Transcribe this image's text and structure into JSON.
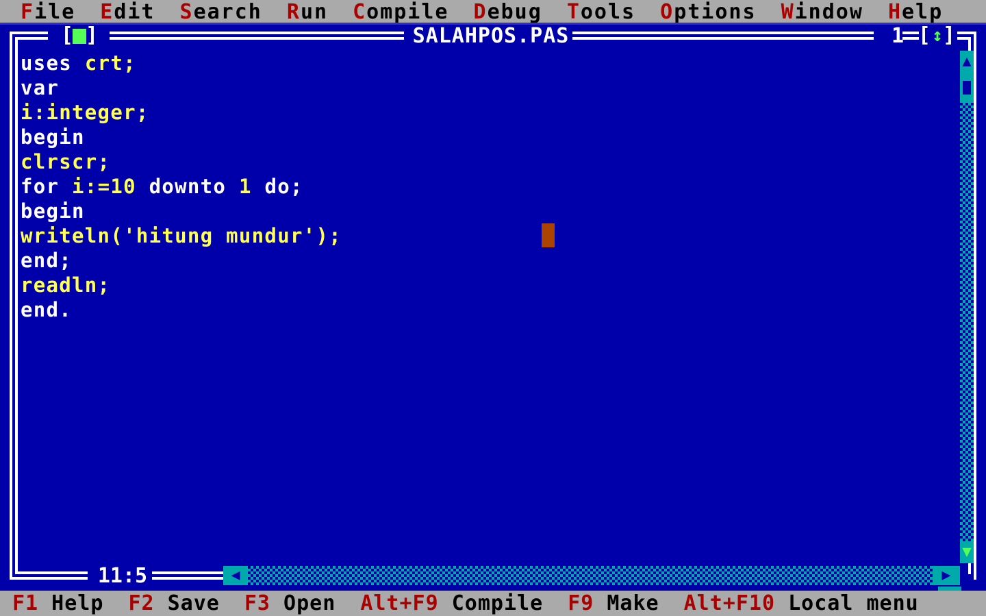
{
  "menubar": {
    "items": [
      {
        "hot": "F",
        "rest": "ile",
        "name": "menu-file"
      },
      {
        "hot": "E",
        "rest": "dit",
        "name": "menu-edit"
      },
      {
        "hot": "S",
        "rest": "earch",
        "name": "menu-search"
      },
      {
        "hot": "R",
        "rest": "un",
        "name": "menu-run"
      },
      {
        "hot": "C",
        "rest": "ompile",
        "name": "menu-compile"
      },
      {
        "hot": "D",
        "rest": "ebug",
        "name": "menu-debug"
      },
      {
        "hot": "T",
        "rest": "ools",
        "name": "menu-tools"
      },
      {
        "hot": "O",
        "rest": "ptions",
        "name": "menu-options"
      },
      {
        "hot": "W",
        "rest": "indow",
        "name": "menu-window"
      },
      {
        "hot": "H",
        "rest": "elp",
        "name": "menu-help"
      }
    ]
  },
  "window": {
    "title": "SALAHPOS.PAS",
    "number": "1",
    "close_button": "[ ]",
    "zoom_button": "[ ]",
    "zoom_arrow": "↕",
    "cursor_position": "11:5"
  },
  "editor": {
    "lines": [
      [
        {
          "t": "uses",
          "c": "kw"
        },
        {
          "t": " ",
          "c": "kw"
        },
        {
          "t": "crt;",
          "c": "id"
        }
      ],
      [
        {
          "t": "var",
          "c": "kw"
        }
      ],
      [
        {
          "t": "i:integer;",
          "c": "id"
        }
      ],
      [
        {
          "t": "begin",
          "c": "kw"
        }
      ],
      [
        {
          "t": "clrscr;",
          "c": "id"
        }
      ],
      [
        {
          "t": "for ",
          "c": "kw"
        },
        {
          "t": "i:=10 ",
          "c": "id"
        },
        {
          "t": "downto ",
          "c": "kw"
        },
        {
          "t": "1 ",
          "c": "id"
        },
        {
          "t": "do;",
          "c": "kw"
        }
      ],
      [
        {
          "t": "begin",
          "c": "kw"
        }
      ],
      [
        {
          "t": "writeln('hitung mundur');",
          "c": "id"
        }
      ],
      [
        {
          "t": "end;",
          "c": "kw"
        }
      ],
      [
        {
          "t": "readln;",
          "c": "id"
        }
      ],
      [
        {
          "t": "end.",
          "c": "kw"
        }
      ]
    ]
  },
  "scrollbars": {
    "v_up": "▲",
    "v_down": "▼",
    "h_left": "◀",
    "h_right": "▶"
  },
  "statusbar": {
    "items": [
      {
        "key": "F1",
        "label": " Help",
        "name": "status-f1-help"
      },
      {
        "key": "F2",
        "label": " Save",
        "name": "status-f2-save"
      },
      {
        "key": "F3",
        "label": " Open",
        "name": "status-f3-open"
      },
      {
        "key": "Alt+F9",
        "label": " Compile",
        "name": "status-altf9-compile"
      },
      {
        "key": "F9",
        "label": " Make",
        "name": "status-f9-make"
      },
      {
        "key": "Alt+F10",
        "label": " Local menu",
        "name": "status-altf10-local-menu"
      }
    ]
  },
  "colors": {
    "background": "#0000aa",
    "bar": "#aaaaaa",
    "hotkey": "#aa0000",
    "keyword": "#ffffff",
    "identifier": "#ffff55",
    "scrollbar": "#00aaaa",
    "accent_green": "#55ff55",
    "cursor_block": "#aa4400"
  }
}
